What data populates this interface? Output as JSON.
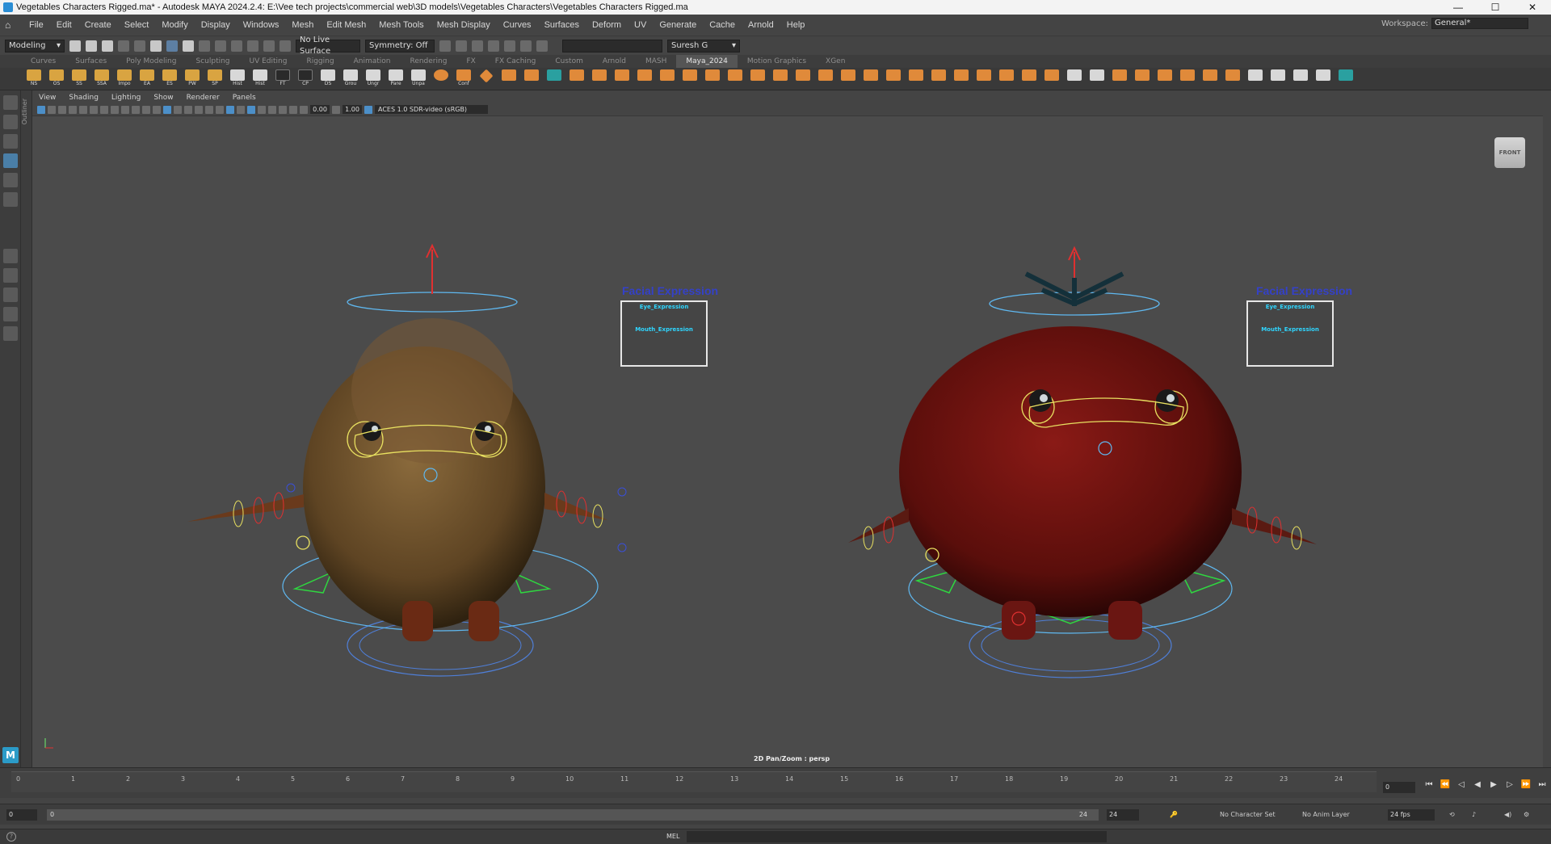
{
  "window": {
    "title": "Vegetables Characters Rigged.ma* - Autodesk MAYA 2024.2.4: E:\\Vee tech projects\\commercial web\\3D models\\Vegetables Characters\\Vegetables Characters Rigged.ma",
    "minimize": "—",
    "maximize": "☐",
    "close": "✕"
  },
  "menus": [
    "File",
    "Edit",
    "Create",
    "Select",
    "Modify",
    "Display",
    "Windows",
    "Mesh",
    "Edit Mesh",
    "Mesh Tools",
    "Mesh Display",
    "Curves",
    "Surfaces",
    "Deform",
    "UV",
    "Generate",
    "Cache",
    "Arnold",
    "Help"
  ],
  "workspace": {
    "label": "Workspace:",
    "value": "General*"
  },
  "status": {
    "mode": "Modeling",
    "live_surface": "No Live Surface",
    "symmetry": "Symmetry: Off",
    "user": "Suresh G"
  },
  "shelf_tabs": [
    "Curves",
    "Surfaces",
    "Poly Modeling",
    "Sculpting",
    "UV Editing",
    "Rigging",
    "Animation",
    "Rendering",
    "FX",
    "FX Caching",
    "Custom",
    "Arnold",
    "MASH",
    "Maya_2024",
    "Motion Graphics",
    "XGen"
  ],
  "active_shelf_tab": "Maya_2024",
  "shelf_buttons": [
    "NS",
    "OS",
    "SS",
    "SSA",
    "Impo",
    "EA",
    "ES",
    "PW",
    "SP",
    "Hist",
    "Hist",
    "FT",
    "CP",
    "DS",
    "Grou",
    "Ungr",
    "Pare",
    "Unpa",
    "",
    "Conf"
  ],
  "outliner_label": "Outliner",
  "viewport": {
    "menus": [
      "View",
      "Shading",
      "Lighting",
      "Show",
      "Renderer",
      "Panels"
    ],
    "exposure": "0.00",
    "gamma": "1.00",
    "colorspace": "ACES 1.0 SDR-video (sRGB)",
    "view_cube": "FRONT",
    "camera_label": "2D Pan/Zoom : persp"
  },
  "facial_panels": [
    {
      "title": "Facial Expression",
      "eye": "Eye_Expression",
      "mouth": "Mouth_Expression"
    },
    {
      "title": "Facial Expression",
      "eye": "Eye_Expression",
      "mouth": "Mouth_Expression"
    }
  ],
  "timeline": {
    "ticks": [
      "1",
      "2",
      "3",
      "4",
      "5",
      "6",
      "7",
      "8",
      "9",
      "10",
      "11",
      "12",
      "13",
      "14",
      "15",
      "16",
      "17",
      "18",
      "19",
      "20",
      "21",
      "22",
      "23",
      "24"
    ],
    "current_frame": "0",
    "frame_marker": "0"
  },
  "range": {
    "start": "0",
    "inner_start": "0",
    "inner_end": "24",
    "end": "24",
    "character_set": "No Character Set",
    "anim_layer": "No Anim Layer",
    "fps": "24 fps"
  },
  "command": {
    "mode": "MEL"
  },
  "colors": {
    "potato": "#7a5a34",
    "tomato": "#7a1512",
    "rig_blue": "#5fb8f0",
    "rig_yellow": "#e8e060",
    "rig_red": "#e03030",
    "rig_green": "#2fd640"
  }
}
